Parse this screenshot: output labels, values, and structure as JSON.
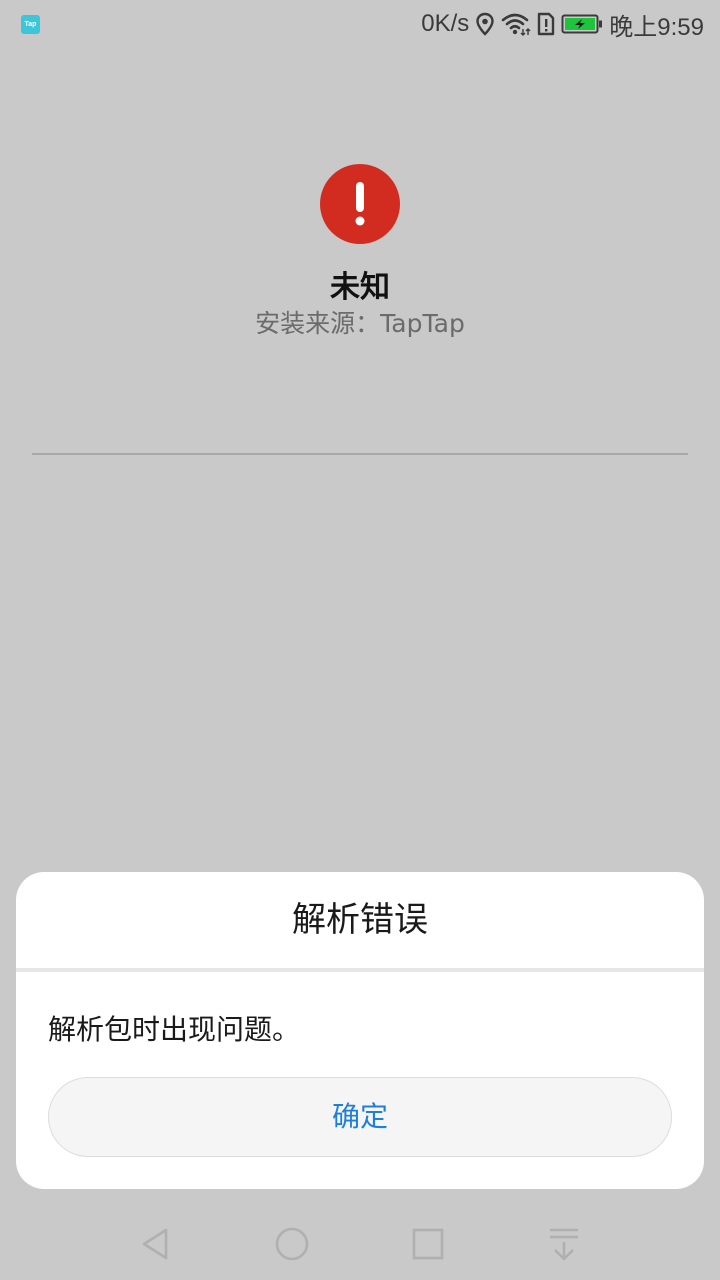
{
  "status_bar": {
    "app_badge": "Tap",
    "network_speed": "0K/s",
    "time": "晚上9:59",
    "icons": [
      "location-icon",
      "wifi-icon",
      "sim-alert-icon",
      "battery-charging-icon"
    ],
    "battery_color": "#1ec43c"
  },
  "app_info": {
    "name": "未知",
    "install_source": "安装来源：TapTap",
    "icon": "error-exclamation-icon",
    "icon_color": "#d22c20"
  },
  "dialog": {
    "title": "解析错误",
    "message": "解析包时出现问题。",
    "confirm_label": "确定",
    "accent_color": "#1e7fdb"
  },
  "nav_bar": {
    "buttons": [
      "back-icon",
      "home-icon",
      "recents-icon",
      "notification-pull-down-icon"
    ]
  }
}
